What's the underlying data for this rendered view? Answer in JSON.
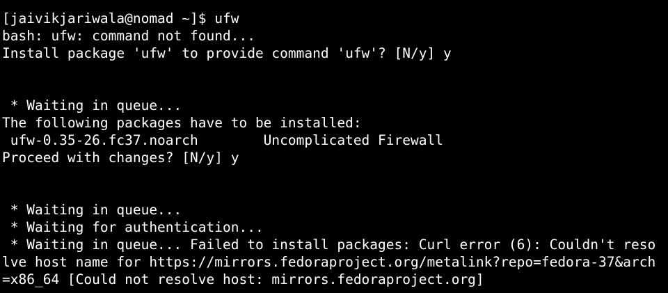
{
  "terminal": {
    "lines": [
      "[jaivikjariwala@nomad ~]$ ufw",
      "bash: ufw: command not found...",
      "Install package 'ufw' to provide command 'ufw'? [N/y] y",
      "",
      "",
      " * Waiting in queue...",
      "The following packages have to be installed:",
      " ufw-0.35-26.fc37.noarch        Uncomplicated Firewall",
      "Proceed with changes? [N/y] y",
      "",
      "",
      " * Waiting in queue...",
      " * Waiting for authentication...",
      " * Waiting in queue... Failed to install packages: Curl error (6): Couldn't reso",
      "lve host name for https://mirrors.fedoraproject.org/metalink?repo=fedora-37&arch",
      "=x86_64 [Could not resolve host: mirrors.fedoraproject.org]"
    ]
  }
}
